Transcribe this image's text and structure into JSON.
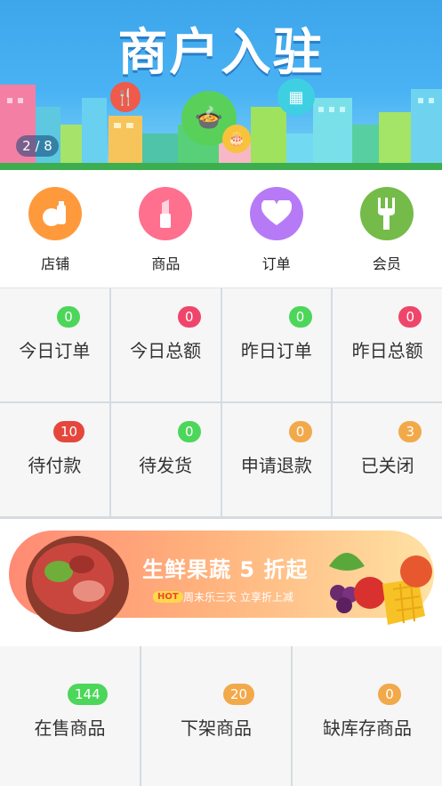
{
  "banner": {
    "title": "商户入驻",
    "counter": "2 / 8",
    "colors": {
      "sky": "#4ab3f4",
      "pin_red": "#ef5a4a",
      "pin_green": "#59d05a",
      "pin_yellow": "#f8c23a"
    }
  },
  "quick_menu": [
    {
      "label": "店铺",
      "icon": "store-icon",
      "color": "#ff9a3c"
    },
    {
      "label": "商品",
      "icon": "lipstick-icon",
      "color": "#ff6f8e"
    },
    {
      "label": "订单",
      "icon": "heart-icon",
      "color": "#b77af6"
    },
    {
      "label": "会员",
      "icon": "fork-icon",
      "color": "#74bb4a"
    }
  ],
  "stats": [
    {
      "label": "今日订单",
      "count": "0",
      "badge_color": "#4cd65a"
    },
    {
      "label": "今日总额",
      "count": "0",
      "badge_color": "#f0456a"
    },
    {
      "label": "昨日订单",
      "count": "0",
      "badge_color": "#4cd65a"
    },
    {
      "label": "昨日总额",
      "count": "0",
      "badge_color": "#f0456a"
    }
  ],
  "orders": [
    {
      "label": "待付款",
      "count": "10",
      "badge_color": "#e5473d"
    },
    {
      "label": "待发货",
      "count": "0",
      "badge_color": "#4cd65a"
    },
    {
      "label": "申请退款",
      "count": "0",
      "badge_color": "#f2a94a"
    },
    {
      "label": "已关闭",
      "count": "3",
      "badge_color": "#f2a94a"
    }
  ],
  "promo": {
    "title": "生鲜果蔬 5 折起",
    "hot": "HOT",
    "subtitle": "周末乐三天 立享折上减"
  },
  "goods": [
    {
      "label": "在售商品",
      "count": "144",
      "badge_color": "#4cd65a"
    },
    {
      "label": "下架商品",
      "count": "20",
      "badge_color": "#f2a94a"
    },
    {
      "label": "缺库存商品",
      "count": "0",
      "badge_color": "#f2a94a"
    }
  ]
}
